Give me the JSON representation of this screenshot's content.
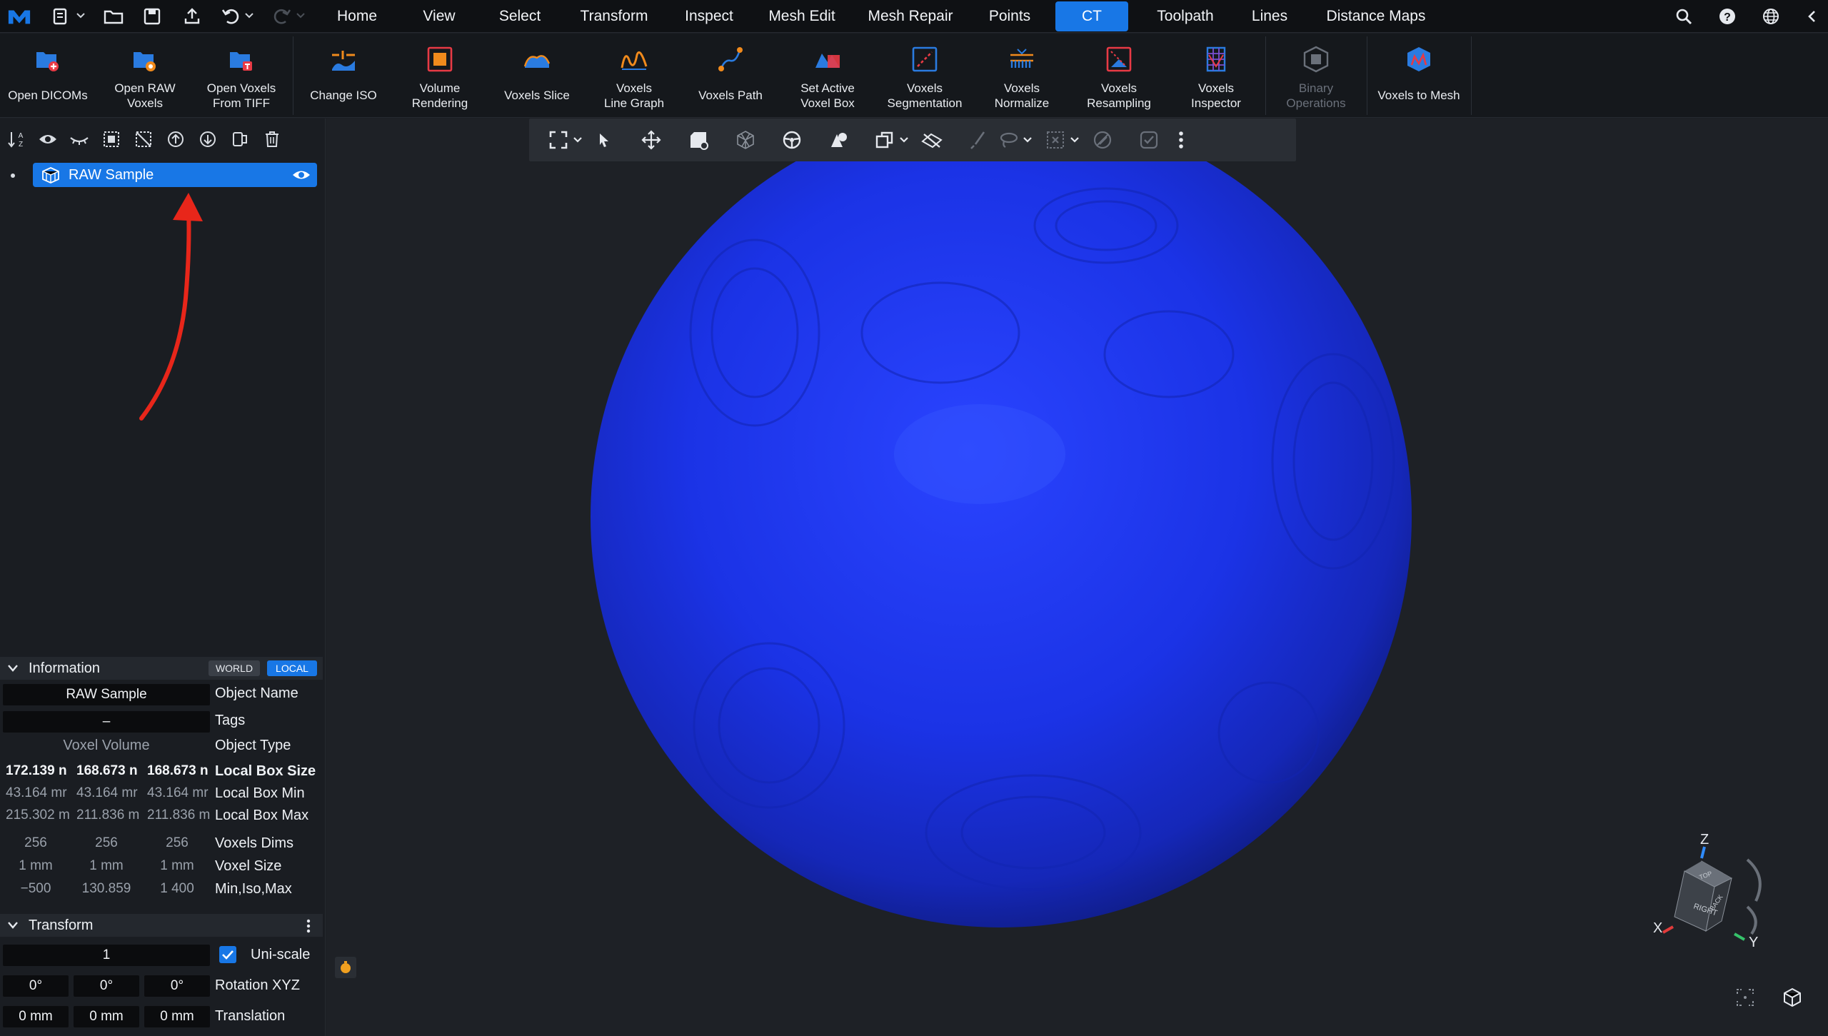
{
  "menubar": {
    "tabs": [
      {
        "label": "Home"
      },
      {
        "label": "View"
      },
      {
        "label": "Select"
      },
      {
        "label": "Transform"
      },
      {
        "label": "Inspect"
      },
      {
        "label": "Mesh Edit"
      },
      {
        "label": "Mesh Repair"
      },
      {
        "label": "Points"
      },
      {
        "label": "CT",
        "active": true
      },
      {
        "label": "Toolpath"
      },
      {
        "label": "Lines"
      },
      {
        "label": "Distance Maps"
      }
    ],
    "left_icons": [
      "app-logo-icon",
      "new-document-icon",
      "open-folder-icon",
      "save-icon",
      "export-icon",
      "undo-icon",
      "redo-icon"
    ],
    "right_icons": [
      "search-icon",
      "help-icon",
      "globe-icon",
      "collapse-icon"
    ],
    "accent": "#1877e6"
  },
  "ribbon": {
    "buttons": [
      {
        "label": "Open DICOMs",
        "icon": "open-dicoms-icon"
      },
      {
        "label": "Open RAW\nVoxels",
        "icon": "open-raw-voxels-icon"
      },
      {
        "label": "Open Voxels\nFrom TIFF",
        "icon": "open-voxels-tiff-icon"
      },
      {
        "label": "Change ISO",
        "icon": "change-iso-icon"
      },
      {
        "label": "Volume\nRendering",
        "icon": "volume-rendering-icon"
      },
      {
        "label": "Voxels Slice",
        "icon": "voxels-slice-icon"
      },
      {
        "label": "Voxels\nLine Graph",
        "icon": "voxels-line-graph-icon"
      },
      {
        "label": "Voxels Path",
        "icon": "voxels-path-icon"
      },
      {
        "label": "Set Active\nVoxel Box",
        "icon": "set-active-voxel-box-icon"
      },
      {
        "label": "Voxels\nSegmentation",
        "icon": "voxels-segmentation-icon"
      },
      {
        "label": "Voxels\nNormalize",
        "icon": "voxels-normalize-icon"
      },
      {
        "label": "Voxels\nResampling",
        "icon": "voxels-resampling-icon"
      },
      {
        "label": "Voxels\nInspector",
        "icon": "voxels-inspector-icon"
      },
      {
        "label": "Binary\nOperations",
        "icon": "binary-operations-icon",
        "disabled": true
      },
      {
        "label": "Voxels to Mesh",
        "icon": "voxels-to-mesh-icon"
      }
    ]
  },
  "scene_tree": {
    "tools": [
      "sort-az-icon",
      "eye-icon",
      "eye-closed-icon",
      "select-all-icon",
      "deselect-icon",
      "move-up-icon",
      "move-down-icon",
      "split-icon",
      "trash-icon"
    ],
    "items": [
      {
        "label": "RAW Sample",
        "selected": true,
        "visible": true
      }
    ]
  },
  "information": {
    "title": "Information",
    "world_label": "WORLD",
    "local_label": "LOCAL",
    "object_name": "RAW Sample",
    "object_name_label": "Object Name",
    "tags": "–",
    "tags_label": "Tags",
    "object_type": "Voxel Volume",
    "object_type_label": "Object Type",
    "local_box_size": [
      "172.139 n",
      "168.673 n",
      "168.673 n"
    ],
    "local_box_size_label": "Local Box Size",
    "local_box_min": [
      "43.164 mr",
      "43.164 mr",
      "43.164 mr"
    ],
    "local_box_min_label": "Local Box Min",
    "local_box_max": [
      "215.302 m",
      "211.836 m",
      "211.836 m"
    ],
    "local_box_max_label": "Local Box Max",
    "voxels_dims": [
      "256",
      "256",
      "256"
    ],
    "voxels_dims_label": "Voxels Dims",
    "voxel_size": [
      "1 mm",
      "1 mm",
      "1 mm"
    ],
    "voxel_size_label": "Voxel Size",
    "min_iso_max": [
      "−500",
      "130.859",
      "1 400"
    ],
    "min_iso_max_label": "Min,Iso,Max"
  },
  "transform": {
    "title": "Transform",
    "scale": "1",
    "uniscale_label": "Uni-scale",
    "uniscale_checked": true,
    "rotation": [
      "0°",
      "0°",
      "0°"
    ],
    "rotation_label": "Rotation XYZ",
    "translation": [
      "0 mm",
      "0 mm",
      "0 mm"
    ],
    "translation_label": "Translation"
  },
  "viewport": {
    "toolbar_icons": [
      "fit-view-icon",
      "pointer-icon",
      "move-icon",
      "screenshot-icon",
      "wireframe-icon",
      "steering-icon",
      "shapes-icon",
      "copy-icon",
      "clip-plane-icon",
      "brush-icon",
      "lasso-icon",
      "deselect-box-icon",
      "disable-icon",
      "check-icon",
      "more-icon"
    ],
    "axis_labels": {
      "z": "Z",
      "x": "X",
      "y": "Y"
    },
    "cube_faces": {
      "right": "RIGHT",
      "back": "BACK",
      "top": "TOP"
    },
    "sphere_color": "#1b2fd6"
  }
}
